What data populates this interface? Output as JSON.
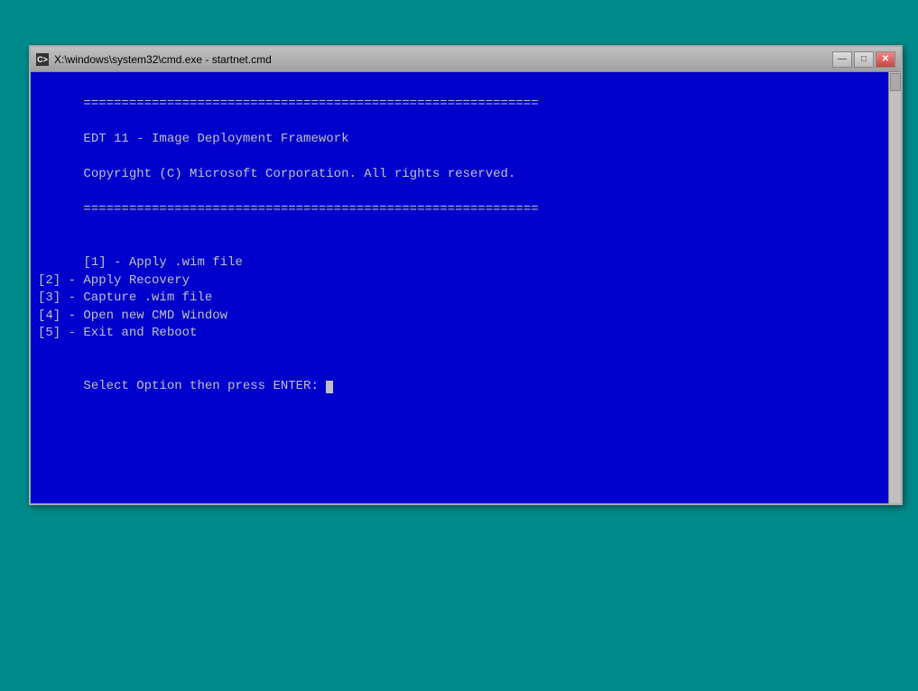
{
  "window": {
    "title": "X:\\windows\\system32\\cmd.exe - startnet.cmd",
    "title_icon": "C>",
    "buttons": {
      "minimize": "—",
      "maximize": "□",
      "close": "✕"
    }
  },
  "terminal": {
    "separator": "============================================================",
    "line1": "EDT 11 - Image Deployment Framework",
    "line2": "Copyright (C) Microsoft Corporation. All rights reserved.",
    "menu_items": [
      "[1] - Apply .wim file",
      "[2] - Apply Recovery",
      "[3] - Capture .wim file",
      "[4] - Open new CMD Window",
      "[5] - Exit and Reboot"
    ],
    "prompt": "Select Option then press ENTER: "
  }
}
